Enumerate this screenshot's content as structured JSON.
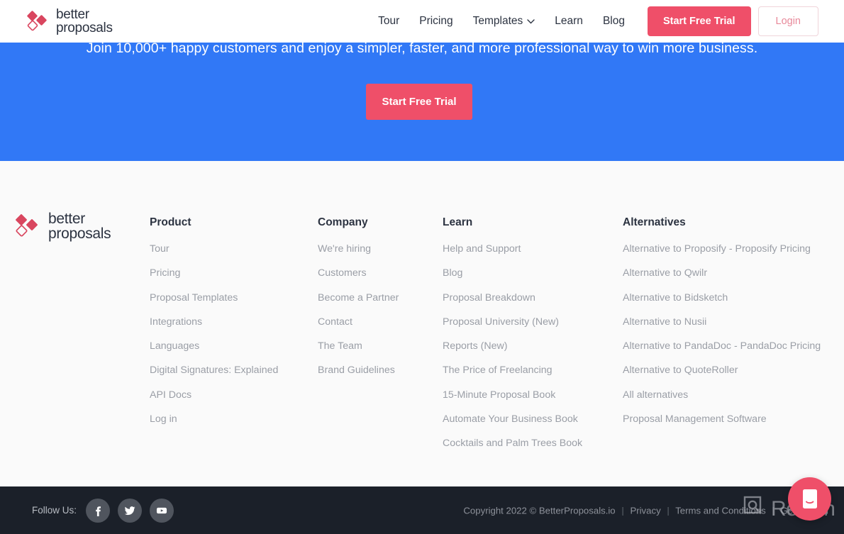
{
  "header": {
    "brand": {
      "line1": "better",
      "line2": "proposals",
      "icon": "diamonds-logo-icon"
    },
    "nav": [
      {
        "label": "Tour",
        "caret": false
      },
      {
        "label": "Pricing",
        "caret": false
      },
      {
        "label": "Templates",
        "caret": true,
        "caret_glyph": "⌄"
      },
      {
        "label": "Learn",
        "caret": false
      },
      {
        "label": "Blog",
        "caret": false
      }
    ],
    "trial_button": "Start Free Trial",
    "login_button": "Login"
  },
  "cta": {
    "headline": "Join 10,000+ happy customers and enjoy a simpler, faster, and more professional way to win more business.",
    "button": "Start Free Trial",
    "bg_color": "#3178f6",
    "button_color": "#ef4f69"
  },
  "footer": {
    "brand": {
      "line1": "better",
      "line2": "proposals"
    },
    "columns": [
      {
        "title": "Product",
        "links": [
          "Tour",
          "Pricing",
          "Proposal Templates",
          "Integrations",
          "Languages",
          "Digital Signatures: Explained",
          "API Docs",
          "Log in"
        ]
      },
      {
        "title": "Company",
        "links": [
          "We're hiring",
          "Customers",
          "Become a Partner",
          "Contact",
          "The Team",
          "Brand Guidelines"
        ]
      },
      {
        "title": "Learn",
        "links": [
          "Help and Support",
          "Blog",
          "Proposal Breakdown",
          "Proposal University (New)",
          "Reports (New)",
          "The Price of Freelancing",
          "15-Minute Proposal Book",
          "Automate Your Business Book",
          "Cocktails and Palm Trees Book"
        ]
      },
      {
        "title": "Alternatives",
        "links": [
          "Alternative to Proposify - Proposify Pricing",
          "Alternative to Qwilr",
          "Alternative to Bidsketch",
          "Alternative to Nusii",
          "Alternative to PandaDoc - PandaDoc Pricing",
          "Alternative to QuoteRoller",
          "All alternatives",
          "Proposal Management Software"
        ]
      }
    ]
  },
  "bottombar": {
    "follow_label": "Follow Us:",
    "socials": [
      {
        "name": "facebook-icon",
        "glyph": "f"
      },
      {
        "name": "twitter-icon",
        "glyph": "t"
      },
      {
        "name": "youtube-icon",
        "glyph": "y"
      }
    ],
    "copyright": "Copyright 2022 © BetterProposals.io",
    "links": [
      "Privacy",
      "Terms and Conditions",
      "Get Started"
    ],
    "separator": "|",
    "bg_color": "#1b2029"
  },
  "chat_widget": {
    "name": "intercom-chat-button",
    "color": "#ef4f69"
  },
  "watermark": {
    "text": "Revain",
    "icon": "revain-logo-icon"
  }
}
